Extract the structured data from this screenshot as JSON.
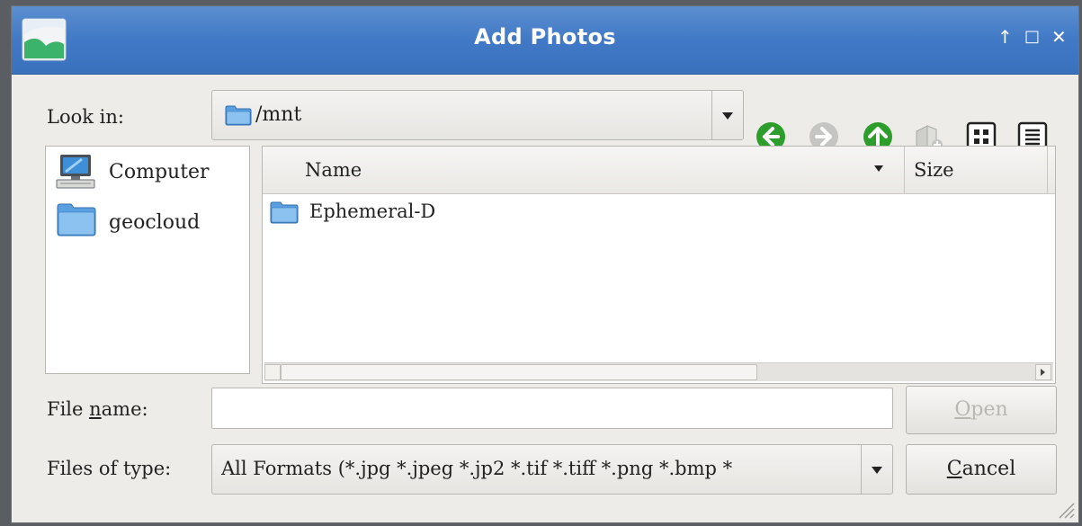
{
  "window": {
    "title": "Add Photos",
    "controls": {
      "keep_above": "↑",
      "maximize": "□",
      "close": "✕"
    }
  },
  "look_in": {
    "label": "Look in:",
    "path": "/mnt"
  },
  "toolbar_icons": [
    "back-icon",
    "forward-icon",
    "up-icon",
    "new-folder-icon",
    "list-view-icon",
    "detail-view-icon"
  ],
  "sidebar": {
    "items": [
      {
        "label": "Computer",
        "icon": "computer-icon"
      },
      {
        "label": "geocloud",
        "icon": "folder-icon"
      }
    ]
  },
  "file_list": {
    "columns": [
      "Name",
      "Size"
    ],
    "rows": [
      {
        "name": "Ephemeral-D",
        "icon": "folder-icon"
      }
    ]
  },
  "file_name": {
    "label_pre": "File ",
    "label_mnemonic": "n",
    "label_post": "ame:",
    "value": ""
  },
  "files_of_type": {
    "label": "Files of type:",
    "value": "All Formats (*.jpg *.jpeg *.jp2 *.tif *.tiff *.png *.bmp *"
  },
  "buttons": {
    "open": {
      "mnemonic": "O",
      "rest": "pen"
    },
    "cancel": {
      "mnemonic": "C",
      "rest": "ancel"
    }
  },
  "colors": {
    "titlebar": "#4179c6",
    "nav_green": "#2d9e2b",
    "folder_blue": "#5aa0e0"
  }
}
